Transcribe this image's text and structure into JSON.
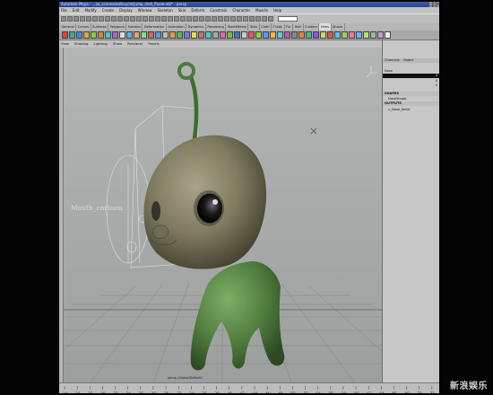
{
  "window": {
    "title_text": "Autodesk Maya - ...aa_scenes/walkcycle/jump_shot_finale.mb* - persp",
    "controls": [
      "_",
      "□",
      "×"
    ]
  },
  "menubar": {
    "items": [
      "File",
      "Edit",
      "Modify",
      "Create",
      "Display",
      "Window",
      "Skeleton",
      "Skin",
      "Deform",
      "Constrain",
      "Character",
      "Muscle",
      "Help"
    ]
  },
  "shelf": {
    "tabs": [
      "General",
      "Curves",
      "Surfaces",
      "Polygons",
      "Subdivs",
      "Deformation",
      "Animation",
      "Dynamics",
      "Rendering",
      "PaintEffects",
      "Toon",
      "Cloth",
      "Fluids",
      "Fur",
      "Hair",
      "Custom",
      "Hires",
      "Shave"
    ],
    "active_tab": "Hires",
    "icon_colors": [
      "#d44",
      "#4a8",
      "#48c",
      "#ca4",
      "#8c4",
      "#c84",
      "#4cc",
      "#a6c",
      "#ddd",
      "#6ad",
      "#da6",
      "#8d8",
      "#c66",
      "#69c",
      "#bbb",
      "#e93",
      "#5b5",
      "#77e",
      "#dd5",
      "#b77",
      "#5cb",
      "#aaa",
      "#d6a",
      "#7b4",
      "#47b",
      "#ccc",
      "#e55",
      "#9c5",
      "#59e",
      "#eb4",
      "#6cc",
      "#b5b",
      "#888",
      "#d84",
      "#4b8",
      "#85d",
      "#cd6",
      "#d55",
      "#6bd",
      "#ac5",
      "#e7a",
      "#7ae",
      "#bd7",
      "#9b9",
      "#c9c",
      "#eee"
    ]
  },
  "panel_menu": {
    "items": [
      "View",
      "Shading",
      "Lighting",
      "Show",
      "Renderer",
      "Panels"
    ]
  },
  "viewport": {
    "camera_label": "persp (Global/Default)",
    "rig_label": "Mouth_cartoon",
    "axes": [
      "x",
      "y",
      "z"
    ],
    "colors": {
      "background_top": "#b3b5b4",
      "character_head": "#7d7a5f",
      "character_body": "#4e7a3e",
      "eye": "#1a1a1a",
      "grid": "#7f8482"
    }
  },
  "channel_box": {
    "tabs": [
      "Channels",
      "Object"
    ],
    "node_name": "Nose",
    "channel_rows": [
      {
        "name": "",
        "value": "0"
      },
      {
        "name": "",
        "value": "0"
      },
      {
        "name": "",
        "value": "0"
      }
    ],
    "shapes_header": "SHAPES",
    "shape_item": "NoseShape",
    "outputs_header": "OUTPUTS",
    "output_item": "n_Nose_facial"
  },
  "timeline": {
    "ticks": [
      "14",
      "16",
      "18",
      "20",
      "22",
      "24",
      "26",
      "28",
      "30",
      "32",
      "34",
      "36",
      "38",
      "40",
      "42",
      "44",
      "46",
      "48",
      "50",
      "52",
      "54",
      "56",
      "58",
      "60",
      "62",
      "64",
      "66",
      "68",
      "70",
      "72"
    ]
  },
  "watermark": {
    "text": "新浪娱乐"
  }
}
